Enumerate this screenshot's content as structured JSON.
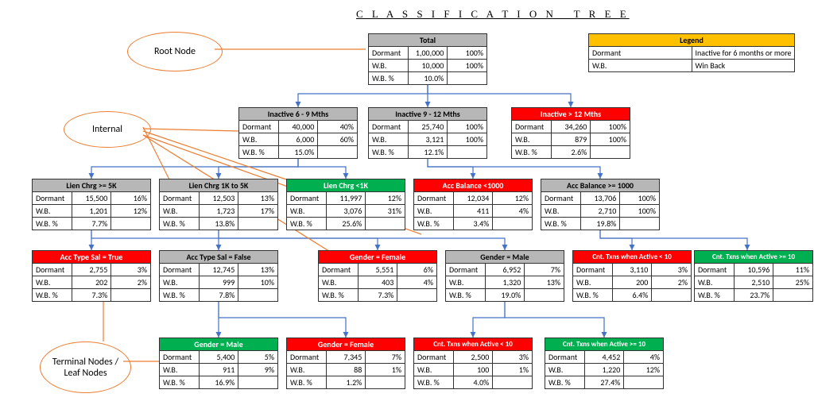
{
  "title": "C L A S S I F I C A T I O N   T R E E",
  "labels": {
    "dormant": "Dormant",
    "wb": "W.B.",
    "wbp": "W.B. %"
  },
  "legend": {
    "header": "Legend",
    "rows": [
      {
        "k": "Dormant",
        "v": "Inactive for 6 months or more"
      },
      {
        "k": "W.B.",
        "v": "Win Back"
      }
    ]
  },
  "annotations": {
    "root": "Root Node",
    "internal": "Internal",
    "terminal": "Terminal Nodes / Leaf Nodes"
  },
  "nodes": {
    "total": {
      "header": "Total",
      "dormant": "1,00,000",
      "dormant_pct": "100%",
      "wb": "10,000",
      "wb_pct": "100%",
      "wbp": "10.0%"
    },
    "l1a": {
      "header": "Inactive 6 - 9 Mths",
      "dormant": "40,000",
      "dormant_pct": "40%",
      "wb": "6,000",
      "wb_pct": "60%",
      "wbp": "15.0%"
    },
    "l1b": {
      "header": "Inactive 9 - 12 Mths",
      "dormant": "25,740",
      "dormant_pct": "100%",
      "wb": "3,121",
      "wb_pct": "100%",
      "wbp": "12.1%"
    },
    "l1c": {
      "header": "Inactive > 12 Mths",
      "dormant": "34,260",
      "dormant_pct": "100%",
      "wb": "879",
      "wb_pct": "100%",
      "wbp": "2.6%"
    },
    "l2a": {
      "header": "Lien Chrg >= 5K",
      "dormant": "15,500",
      "dormant_pct": "16%",
      "wb": "1,201",
      "wb_pct": "12%",
      "wbp": "7.7%"
    },
    "l2b": {
      "header": "Lien Chrg 1K to 5K",
      "dormant": "12,503",
      "dormant_pct": "13%",
      "wb": "1,723",
      "wb_pct": "17%",
      "wbp": "13.8%"
    },
    "l2c": {
      "header": "Lien Chrg <1K",
      "dormant": "11,997",
      "dormant_pct": "12%",
      "wb": "3,076",
      "wb_pct": "31%",
      "wbp": "25.6%"
    },
    "l2d": {
      "header": "Acc Balance <1000",
      "dormant": "12,034",
      "dormant_pct": "12%",
      "wb": "411",
      "wb_pct": "4%",
      "wbp": "3.4%"
    },
    "l2e": {
      "header": "Acc Balance >= 1000",
      "dormant": "13,706",
      "dormant_pct": "100%",
      "wb": "2,710",
      "wb_pct": "100%",
      "wbp": "19.8%"
    },
    "l3a": {
      "header": "Acc Type Sal = True",
      "dormant": "2,755",
      "dormant_pct": "3%",
      "wb": "202",
      "wb_pct": "2%",
      "wbp": "7.3%"
    },
    "l3b": {
      "header": "Acc Type Sal = False",
      "dormant": "12,745",
      "dormant_pct": "13%",
      "wb": "999",
      "wb_pct": "10%",
      "wbp": "7.8%"
    },
    "l3c": {
      "header": "Gender = Female",
      "dormant": "5,551",
      "dormant_pct": "6%",
      "wb": "403",
      "wb_pct": "4%",
      "wbp": "7.3%"
    },
    "l3d": {
      "header": "Gender = Male",
      "dormant": "6,952",
      "dormant_pct": "7%",
      "wb": "1,320",
      "wb_pct": "13%",
      "wbp": "19.0%"
    },
    "l3e": {
      "header": "Cnt. Txns when Active < 10",
      "dormant": "3,110",
      "dormant_pct": "3%",
      "wb": "200",
      "wb_pct": "2%",
      "wbp": "6.4%"
    },
    "l3f": {
      "header": "Cnt. Txns when Active >= 10",
      "dormant": "10,596",
      "dormant_pct": "11%",
      "wb": "2,510",
      "wb_pct": "25%",
      "wbp": "23.7%"
    },
    "l4a": {
      "header": "Gender = Male",
      "dormant": "5,400",
      "dormant_pct": "5%",
      "wb": "911",
      "wb_pct": "9%",
      "wbp": "16.9%"
    },
    "l4b": {
      "header": "Gender = Female",
      "dormant": "7,345",
      "dormant_pct": "7%",
      "wb": "88",
      "wb_pct": "1%",
      "wbp": "1.2%"
    },
    "l4c": {
      "header": "Cnt. Txns when Active < 10",
      "dormant": "2,500",
      "dormant_pct": "3%",
      "wb": "100",
      "wb_pct": "1%",
      "wbp": "4.0%"
    },
    "l4d": {
      "header": "Cnt. Txns when Active >= 10",
      "dormant": "4,452",
      "dormant_pct": "4%",
      "wb": "1,220",
      "wb_pct": "12%",
      "wbp": "27.4%"
    }
  },
  "chart_data": {
    "type": "table",
    "description": "Classification tree. Each node has header color (gray=normal, red=terminal-low, green=terminal-high), and metrics Dormant count/%, Win-Back count/%, Win-Back rate.",
    "nodes": [
      {
        "id": "total",
        "parent": null,
        "header": "Total",
        "color": "gray",
        "dormant": 100000,
        "dormant_pct": 100,
        "wb": 10000,
        "wb_pct": 100,
        "wb_rate": 10.0
      },
      {
        "id": "l1a",
        "parent": "total",
        "header": "Inactive 6 - 9 Mths",
        "color": "gray",
        "dormant": 40000,
        "dormant_pct": 40,
        "wb": 6000,
        "wb_pct": 60,
        "wb_rate": 15.0
      },
      {
        "id": "l1b",
        "parent": "total",
        "header": "Inactive 9 - 12 Mths",
        "color": "gray",
        "dormant": 25740,
        "dormant_pct": 100,
        "wb": 3121,
        "wb_pct": 100,
        "wb_rate": 12.1
      },
      {
        "id": "l1c",
        "parent": "total",
        "header": "Inactive > 12 Mths",
        "color": "red",
        "dormant": 34260,
        "dormant_pct": 100,
        "wb": 879,
        "wb_pct": 100,
        "wb_rate": 2.6
      },
      {
        "id": "l2a",
        "parent": "l1a",
        "header": "Lien Chrg >= 5K",
        "color": "gray",
        "dormant": 15500,
        "dormant_pct": 16,
        "wb": 1201,
        "wb_pct": 12,
        "wb_rate": 7.7
      },
      {
        "id": "l2b",
        "parent": "l1a",
        "header": "Lien Chrg 1K to 5K",
        "color": "gray",
        "dormant": 12503,
        "dormant_pct": 13,
        "wb": 1723,
        "wb_pct": 17,
        "wb_rate": 13.8
      },
      {
        "id": "l2c",
        "parent": "l1a",
        "header": "Lien Chrg <1K",
        "color": "green",
        "dormant": 11997,
        "dormant_pct": 12,
        "wb": 3076,
        "wb_pct": 31,
        "wb_rate": 25.6
      },
      {
        "id": "l2d",
        "parent": "l1b",
        "header": "Acc Balance <1000",
        "color": "red",
        "dormant": 12034,
        "dormant_pct": 12,
        "wb": 411,
        "wb_pct": 4,
        "wb_rate": 3.4
      },
      {
        "id": "l2e",
        "parent": "l1b",
        "header": "Acc Balance >= 1000",
        "color": "gray",
        "dormant": 13706,
        "dormant_pct": 100,
        "wb": 2710,
        "wb_pct": 100,
        "wb_rate": 19.8
      },
      {
        "id": "l3a",
        "parent": "l2a",
        "header": "Acc Type Sal = True",
        "color": "red",
        "dormant": 2755,
        "dormant_pct": 3,
        "wb": 202,
        "wb_pct": 2,
        "wb_rate": 7.3
      },
      {
        "id": "l3b",
        "parent": "l2a",
        "header": "Acc Type Sal = False",
        "color": "gray",
        "dormant": 12745,
        "dormant_pct": 13,
        "wb": 999,
        "wb_pct": 10,
        "wb_rate": 7.8
      },
      {
        "id": "l3c",
        "parent": "l2b",
        "header": "Gender = Female",
        "color": "red",
        "dormant": 5551,
        "dormant_pct": 6,
        "wb": 403,
        "wb_pct": 4,
        "wb_rate": 7.3
      },
      {
        "id": "l3d",
        "parent": "l2b",
        "header": "Gender = Male",
        "color": "gray",
        "dormant": 6952,
        "dormant_pct": 7,
        "wb": 1320,
        "wb_pct": 13,
        "wb_rate": 19.0
      },
      {
        "id": "l3e",
        "parent": "l2e",
        "header": "Cnt. Txns when Active < 10",
        "color": "red",
        "dormant": 3110,
        "dormant_pct": 3,
        "wb": 200,
        "wb_pct": 2,
        "wb_rate": 6.4
      },
      {
        "id": "l3f",
        "parent": "l2e",
        "header": "Cnt. Txns when Active >= 10",
        "color": "green",
        "dormant": 10596,
        "dormant_pct": 11,
        "wb": 2510,
        "wb_pct": 25,
        "wb_rate": 23.7
      },
      {
        "id": "l4a",
        "parent": "l3b",
        "header": "Gender = Male",
        "color": "green",
        "dormant": 5400,
        "dormant_pct": 5,
        "wb": 911,
        "wb_pct": 9,
        "wb_rate": 16.9
      },
      {
        "id": "l4b",
        "parent": "l3b",
        "header": "Gender = Female",
        "color": "red",
        "dormant": 7345,
        "dormant_pct": 7,
        "wb": 88,
        "wb_pct": 1,
        "wb_rate": 1.2
      },
      {
        "id": "l4c",
        "parent": "l3d",
        "header": "Cnt. Txns when Active < 10",
        "color": "red",
        "dormant": 2500,
        "dormant_pct": 3,
        "wb": 100,
        "wb_pct": 1,
        "wb_rate": 4.0
      },
      {
        "id": "l4d",
        "parent": "l3d",
        "header": "Cnt. Txns when Active >= 10",
        "color": "green",
        "dormant": 4452,
        "dormant_pct": 4,
        "wb": 1220,
        "wb_pct": 12,
        "wb_rate": 27.4
      }
    ]
  }
}
